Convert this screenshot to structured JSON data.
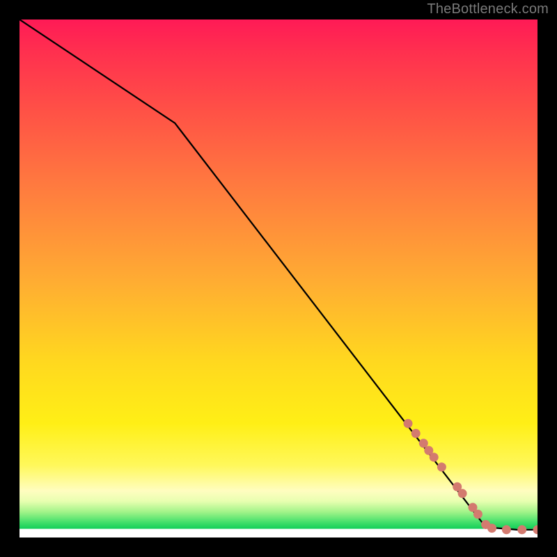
{
  "attribution": "TheBottleneck.com",
  "chart_data": {
    "type": "line",
    "title": "",
    "xlabel": "",
    "ylabel": "",
    "xlim": [
      0,
      100
    ],
    "ylim": [
      0,
      100
    ],
    "grid": false,
    "legend": false,
    "note": "Axes and units are not shown in the image; x/y values below are normalized 0–100 across the plotting area (origin bottom-left).",
    "line": [
      {
        "x": 0,
        "y": 100
      },
      {
        "x": 30,
        "y": 80
      },
      {
        "x": 90,
        "y": 2
      },
      {
        "x": 96,
        "y": 1.5
      },
      {
        "x": 100,
        "y": 1.5
      }
    ],
    "points": [
      {
        "x": 75.0,
        "y": 22.0
      },
      {
        "x": 76.5,
        "y": 20.1
      },
      {
        "x": 78.0,
        "y": 18.2
      },
      {
        "x": 79.0,
        "y": 16.8
      },
      {
        "x": 80.0,
        "y": 15.5
      },
      {
        "x": 81.5,
        "y": 13.6
      },
      {
        "x": 84.5,
        "y": 9.8
      },
      {
        "x": 85.5,
        "y": 8.5
      },
      {
        "x": 87.5,
        "y": 5.8
      },
      {
        "x": 88.5,
        "y": 4.5
      },
      {
        "x": 90.0,
        "y": 2.5
      },
      {
        "x": 91.2,
        "y": 1.8
      },
      {
        "x": 94.0,
        "y": 1.5
      },
      {
        "x": 97.0,
        "y": 1.5
      },
      {
        "x": 100.0,
        "y": 1.5
      }
    ],
    "background_gradient": {
      "direction": "vertical",
      "stops": [
        {
          "pos": 0.0,
          "color": "#ff1a56"
        },
        {
          "pos": 0.5,
          "color": "#ffab33"
        },
        {
          "pos": 0.78,
          "color": "#ffef16"
        },
        {
          "pos": 0.95,
          "color": "#a4f48a"
        },
        {
          "pos": 0.983,
          "color": "#13cf59"
        },
        {
          "pos": 1.0,
          "color": "#ffffff"
        }
      ]
    },
    "point_color": "#d37a6f",
    "line_color": "#000000"
  }
}
